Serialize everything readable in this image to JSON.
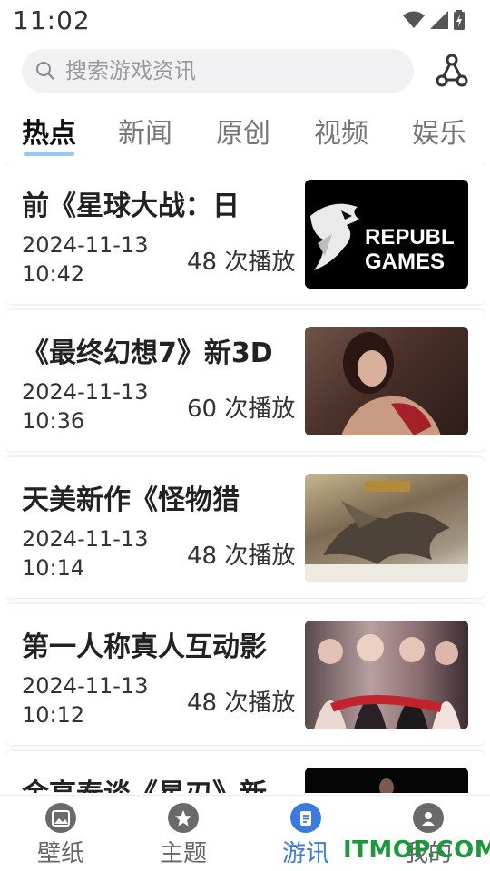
{
  "status_bar": {
    "time": "11:02"
  },
  "search": {
    "placeholder": "搜索游戏资讯"
  },
  "tabs": [
    {
      "label": "热点",
      "active": true
    },
    {
      "label": "新闻",
      "active": false
    },
    {
      "label": "原创",
      "active": false
    },
    {
      "label": "视频",
      "active": false
    },
    {
      "label": "娱乐",
      "active": false
    }
  ],
  "articles": [
    {
      "title": "前《星球大战：日",
      "date": "2024-11-13",
      "time": "10:42",
      "plays": "48 次播放",
      "thumb_text": [
        "REPUBL",
        "GAMES"
      ]
    },
    {
      "title": "《最终幻想7》新3D",
      "date": "2024-11-13",
      "time": "10:36",
      "plays": "60 次播放"
    },
    {
      "title": "天美新作《怪物猎",
      "date": "2024-11-13",
      "time": "10:14",
      "plays": "48 次播放"
    },
    {
      "title": "第一人称真人互动影",
      "date": "2024-11-13",
      "time": "10:12",
      "plays": "48 次播放"
    },
    {
      "title": "金亨泰谈《星刃》新",
      "date": "",
      "time": "",
      "plays": ""
    }
  ],
  "bottom_nav": [
    {
      "label": "壁纸",
      "icon": "wallpaper-icon",
      "active": false
    },
    {
      "label": "主题",
      "icon": "theme-icon",
      "active": false
    },
    {
      "label": "游讯",
      "icon": "news-icon",
      "active": true
    },
    {
      "label": "我的",
      "icon": "profile-icon",
      "active": false
    }
  ],
  "watermark": "ITMOP.COM",
  "colors": {
    "accent": "#3a7be0",
    "tab_underline": "#7fb6f0",
    "watermark": "#1a9a3a"
  }
}
